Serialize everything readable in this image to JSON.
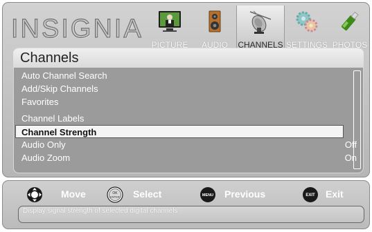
{
  "brand": {
    "name": "INSIGNIA"
  },
  "tabs": [
    {
      "id": "picture",
      "label": "PICTURE",
      "icon": "tv-picture-icon",
      "active": false
    },
    {
      "id": "audio",
      "label": "AUDIO",
      "icon": "speaker-icon",
      "active": false
    },
    {
      "id": "channels",
      "label": "CHANNELS",
      "icon": "satellite-dish-icon",
      "active": true
    },
    {
      "id": "settings",
      "label": "SETTINGS",
      "icon": "gears-icon",
      "active": false
    },
    {
      "id": "photos",
      "label": "PHOTOS",
      "icon": "usb-drive-icon",
      "active": false
    }
  ],
  "menu": {
    "title": "Channels",
    "items": [
      {
        "label": "Auto Channel Search",
        "value": ""
      },
      {
        "label": "Add/Skip Channels",
        "value": ""
      },
      {
        "label": "Favorites",
        "value": ""
      },
      {
        "label": "Channel Labels",
        "value": ""
      },
      {
        "label": "Channel Strength",
        "value": "",
        "selected": true
      },
      {
        "label": "Audio Only",
        "value": "Off"
      },
      {
        "label": "Audio Zoom",
        "value": "On"
      }
    ]
  },
  "legend": {
    "move": {
      "label": "Move",
      "icon": "dpad-icon"
    },
    "select": {
      "label": "Select",
      "icon": "ok-enter-icon",
      "key_text": "OK ENTER"
    },
    "previous": {
      "label": "Previous",
      "icon": "menu-button-icon",
      "key_text": "MENU"
    },
    "exit": {
      "label": "Exit",
      "icon": "exit-button-icon",
      "key_text": "EXIT"
    }
  },
  "help_text": "Display signal strength of selected digital channels",
  "colors": {
    "panel": "#c4c4c4",
    "list_bg": "#9b9b9b",
    "highlight": "#f4f4f4"
  }
}
